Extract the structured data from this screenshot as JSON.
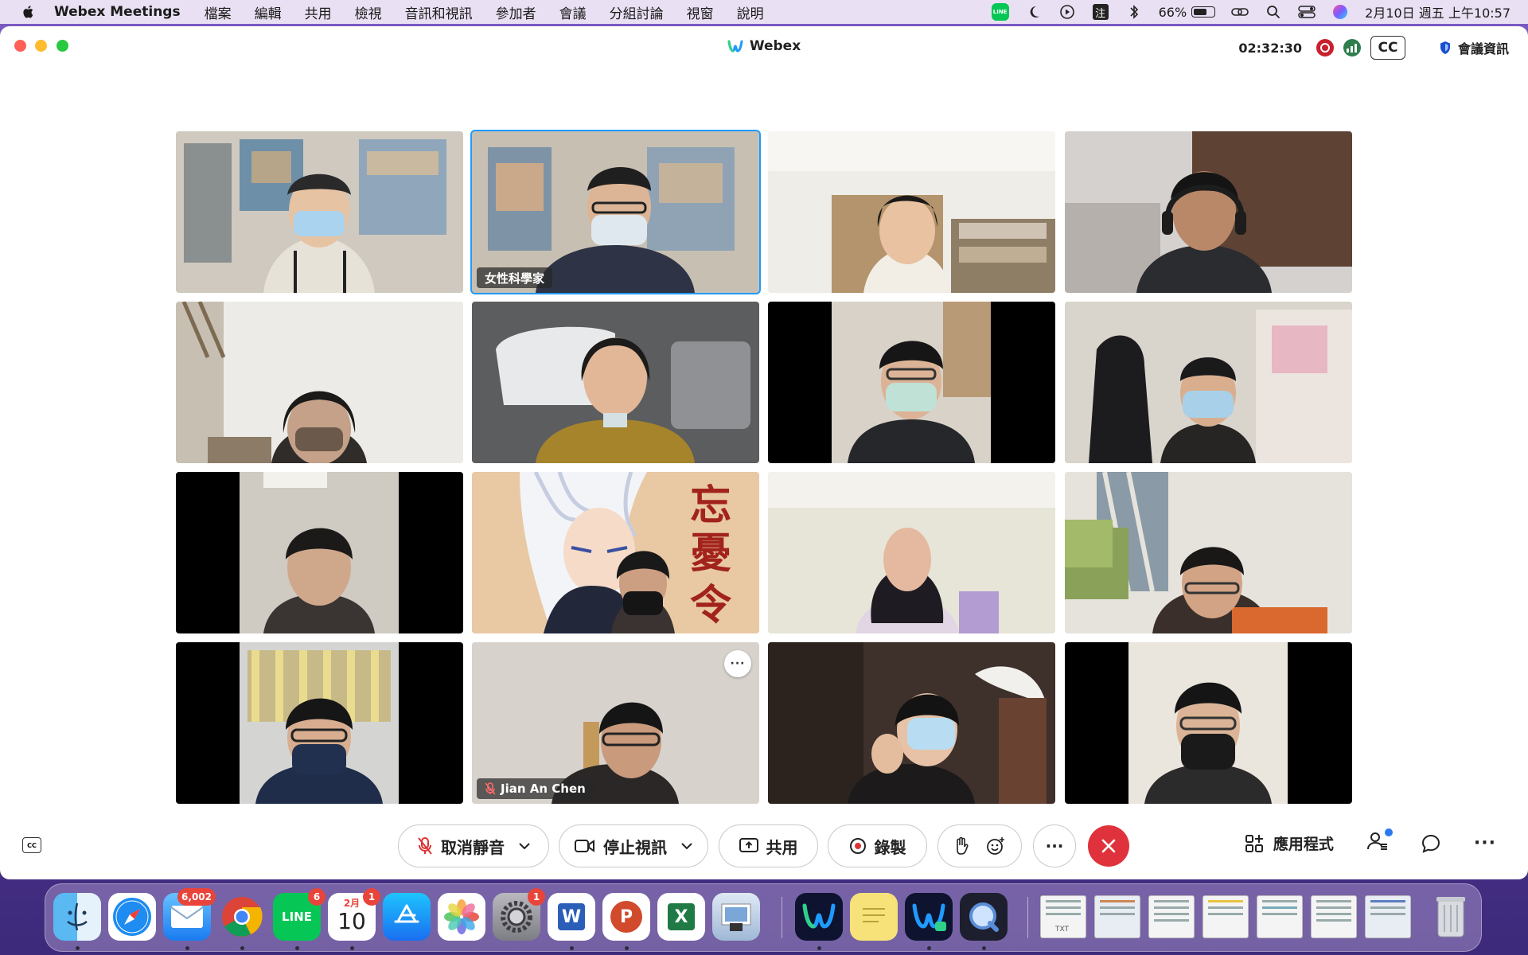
{
  "menubar": {
    "app_name": "Webex Meetings",
    "items": [
      "檔案",
      "編輯",
      "共用",
      "檢視",
      "音訊和視訊",
      "參加者",
      "會議",
      "分組討論",
      "視窗",
      "說明"
    ],
    "battery_percent": "66%",
    "battery_level": 0.66,
    "datetime": "2月10日 週五 上午10:57",
    "input_method": "注",
    "line_label": "LINE"
  },
  "window": {
    "title": "Webex",
    "timer": "02:32:30",
    "cc_label": "CC",
    "meeting_info_label": "會議資訊"
  },
  "grid": {
    "tiles": [
      {
        "name": ""
      },
      {
        "name": "女性科學家",
        "active": true
      },
      {
        "name": ""
      },
      {
        "name": ""
      },
      {
        "name": ""
      },
      {
        "name": ""
      },
      {
        "name": ""
      },
      {
        "name": ""
      },
      {
        "name": ""
      },
      {
        "name": ""
      },
      {
        "name": ""
      },
      {
        "name": ""
      },
      {
        "name": ""
      },
      {
        "name": "Jian An Chen",
        "muted": true,
        "more": "···"
      },
      {
        "name": ""
      },
      {
        "name": ""
      }
    ]
  },
  "controls": {
    "cc_small": "CC",
    "unmute_label": "取消靜音",
    "stop_video_label": "停止視訊",
    "share_label": "共用",
    "record_label": "錄製",
    "more_label": "···",
    "apps_label": "應用程式",
    "overflow_label": "···"
  },
  "dock": {
    "mail_badge": "6,002",
    "line_badge": "6",
    "calendar_badge": "1",
    "calendar_month": "2月",
    "calendar_day": "10",
    "settings_badge": "1",
    "line_label": "LINE",
    "word_letter": "W",
    "ppt_letter": "P",
    "excel_letter": "X",
    "txt_label": "TXT"
  },
  "colors": {
    "webex_blue": "#1f9bff",
    "end_red": "#e0323c",
    "rec_red": "#c8202d",
    "line_green": "#06c755"
  }
}
